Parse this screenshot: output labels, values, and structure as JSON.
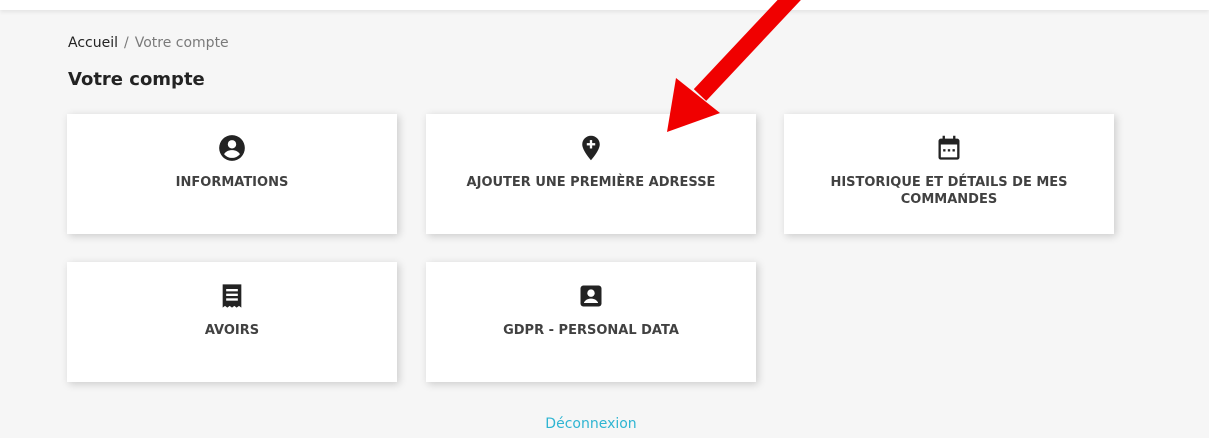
{
  "breadcrumb": {
    "home": "Accueil",
    "separator": "/",
    "current": "Votre compte"
  },
  "page_title": "Votre compte",
  "cards": {
    "informations": {
      "label": "INFORMATIONS",
      "icon": "account-circle-icon"
    },
    "address": {
      "label": "AJOUTER UNE PREMIÈRE ADRESSE",
      "icon": "add-location-icon"
    },
    "history": {
      "label": "HISTORIQUE ET DÉTAILS DE MES COMMANDES",
      "icon": "calendar-icon"
    },
    "avoirs": {
      "label": "AVOIRS",
      "icon": "receipt-icon"
    },
    "gdpr": {
      "label": "GDPR - PERSONAL DATA",
      "icon": "account-box-icon"
    }
  },
  "logout_label": "Déconnexion",
  "colors": {
    "background": "#f6f6f6",
    "card": "#ffffff",
    "text": "#232323",
    "link": "#2fb5d2",
    "annotation_arrow": "#f00000"
  }
}
